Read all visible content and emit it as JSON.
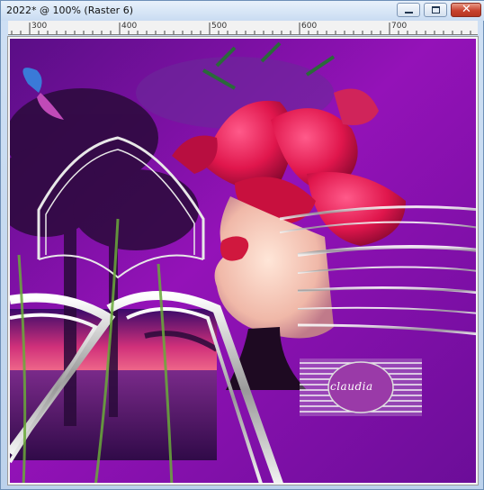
{
  "window": {
    "title": "2022* @ 100% (Raster 6)",
    "controls": {
      "minimize_icon": "minimize-icon",
      "maximize_icon": "maximize-icon",
      "close_icon": "close-icon"
    }
  },
  "ruler": {
    "labels": [
      "300",
      "400",
      "500",
      "600",
      "700"
    ]
  },
  "artwork": {
    "watermark_text": "claudia",
    "colors": {
      "primary": "#8b12b0",
      "accent": "#e0164c",
      "frame": "#f4f4f4"
    }
  }
}
